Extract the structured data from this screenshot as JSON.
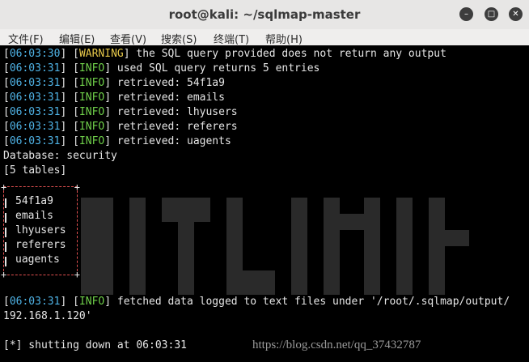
{
  "window": {
    "title": "root@kali: ~/sqlmap-master"
  },
  "menu": [
    "文件(F)",
    "编辑(E)",
    "查看(V)",
    "搜索(S)",
    "终端(T)",
    "帮助(H)"
  ],
  "log": [
    {
      "time": "06:03:30",
      "level": "WARNING",
      "msg": " the SQL query provided does not return any output"
    },
    {
      "time": "06:03:31",
      "level": "INFO",
      "msg": " used SQL query returns 5 entries"
    },
    {
      "time": "06:03:31",
      "level": "INFO",
      "msg": " retrieved: 54f1a9"
    },
    {
      "time": "06:03:31",
      "level": "INFO",
      "msg": " retrieved: emails"
    },
    {
      "time": "06:03:31",
      "level": "INFO",
      "msg": " retrieved: lhyusers"
    },
    {
      "time": "06:03:31",
      "level": "INFO",
      "msg": " retrieved: referers"
    },
    {
      "time": "06:03:31",
      "level": "INFO",
      "msg": " retrieved: uagents"
    }
  ],
  "database_line": "Database: security",
  "tables_count_line": "[5 tables]",
  "tables": [
    "54f1a9",
    "emails",
    "lhyusers",
    "referers",
    "uagents"
  ],
  "fetched": {
    "time": "06:03:31",
    "level": "INFO",
    "msg": " fetched data logged to text files under '/root/.sqlmap/output/",
    "continuation": "192.168.1.120'"
  },
  "shutdown_line": "[*] shutting down at 06:03:31",
  "watermark": "https://blog.csdn.net/qq_37432787",
  "colors": {
    "time": "#4fb3e6",
    "warning": "#e6c84a",
    "info": "#6fcf4a",
    "table_border": "#e05050"
  },
  "icons": [
    "minimize-icon",
    "maximize-icon",
    "close-icon"
  ]
}
